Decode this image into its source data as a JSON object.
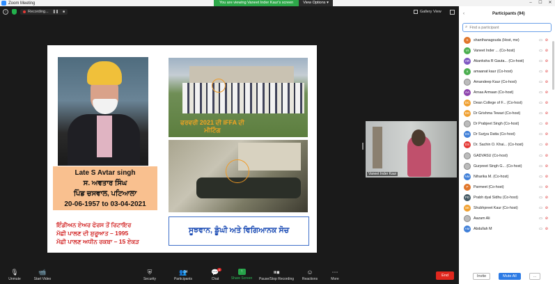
{
  "window": {
    "title": "Zoom Meeting"
  },
  "banner": {
    "text": "You are viewing Vaneet Inder Kaur's screen",
    "view_options": "View Options ▾"
  },
  "topbar": {
    "recording": "Recording...",
    "pause": "❚❚",
    "stop": "■",
    "gallery_view": "Gallery View"
  },
  "slide": {
    "name_en": "Late S Avtar singh",
    "name_pa": "ਸ. ਅਵਤਾਰ ਸਿੰਘ",
    "village": "ਪਿੰਡ ਚਸਵਾਲ, ਪਟਿਆਲਾ",
    "dates": "20-06-1957 to 03-04-2021",
    "line1": "ਇੰਡੀਅਨ ਏਅਰ ਫੋਰਸ ਤੋਂ ਰਿਟਾਇਰ",
    "line2": "ਮੱਛੀ ਪਾਲਣ ਦੀ ਸ਼ੁਰੂਆਤ – 1995",
    "line3": "ਮੱਛੀ ਪਾਲਣ ਅਧੀਨ ਰਕਬਾ – 15 ਏਕੜ",
    "photo_caption": "ਫਰਵਰੀ 2021 ਦੀ IFFA ਦੀ ਮੀਟਿੰਗ",
    "motto": "ਸੂਝਵਾਨ, ਡੂੰਘੀ ਅਤੇ ਵਿਗਿਆਨਕ ਸੋਚ"
  },
  "video": {
    "name": "Vaneet Inder Kaur"
  },
  "toolbar": {
    "unmute": "Unmute",
    "start_video": "Start Video",
    "security": "Security",
    "participants": "Participants",
    "participants_count": "94",
    "chat": "Chat",
    "chat_badge": "4",
    "share_screen": "Share Screen",
    "record": "Pause/Stop Recording",
    "reactions": "Reactions",
    "more": "More",
    "end": "End"
  },
  "panel": {
    "title": "Participants (94)",
    "search_placeholder": "Find a participant",
    "participants": [
      {
        "initials": "S",
        "color": "#e0762b",
        "name": "shanthanagouda (Host, me)"
      },
      {
        "initials": "VI",
        "color": "#4caf50",
        "name": "Vaneet Inder ... (Co-host)"
      },
      {
        "initials": "AR",
        "color": "#7e57c2",
        "name": "Akanksha R Gauta... (Co-host)"
      },
      {
        "initials": "a",
        "color": "#4caf50",
        "name": "amaanat kaur (Co-host)"
      },
      {
        "initials": "",
        "color": "#bbbbbb",
        "name": "Amandeep Kaur (Co-host)"
      },
      {
        "initials": "AA",
        "color": "#8e44ad",
        "name": "Arnaa Armaan (Co-host)"
      },
      {
        "initials": "DC",
        "color": "#f0a030",
        "name": "Dean College of F... (Co-host)"
      },
      {
        "initials": "DG",
        "color": "#f0a030",
        "name": "Dr Grishma Tewari (Co-host)"
      },
      {
        "initials": "",
        "color": "#bbbbbb",
        "name": "Dr Prabjeet Singh (Co-host)"
      },
      {
        "initials": "DS",
        "color": "#3f7fd8",
        "name": "Dr Surjya Datta (Co-host)"
      },
      {
        "initials": "DS",
        "color": "#e53935",
        "name": "Dr. Sachin O. Khai... (Co-host)"
      },
      {
        "initials": "",
        "color": "#bbbbbb",
        "name": "GADVASU (Co-host)"
      },
      {
        "initials": "",
        "color": "#bbbbbb",
        "name": "Gurpreet Singh G... (Co-host)"
      },
      {
        "initials": "NM",
        "color": "#3f7fd8",
        "name": "Niharika M. (Co-host)"
      },
      {
        "initials": "P",
        "color": "#e0762b",
        "name": "Parmeet (Co-host)"
      },
      {
        "initials": "PD",
        "color": "#455a64",
        "name": "Prabh dyal Sidhu (Co-host)"
      },
      {
        "initials": "SK",
        "color": "#f0a030",
        "name": "Shubhpreet Kaur (Co-host)"
      },
      {
        "initials": "",
        "color": "#bbbbbb",
        "name": "Aazam Ali"
      },
      {
        "initials": "AM",
        "color": "#3f7fd8",
        "name": "Abdullah M"
      }
    ],
    "invite": "Invite",
    "mute_all": "Mute All",
    "more": "..."
  }
}
